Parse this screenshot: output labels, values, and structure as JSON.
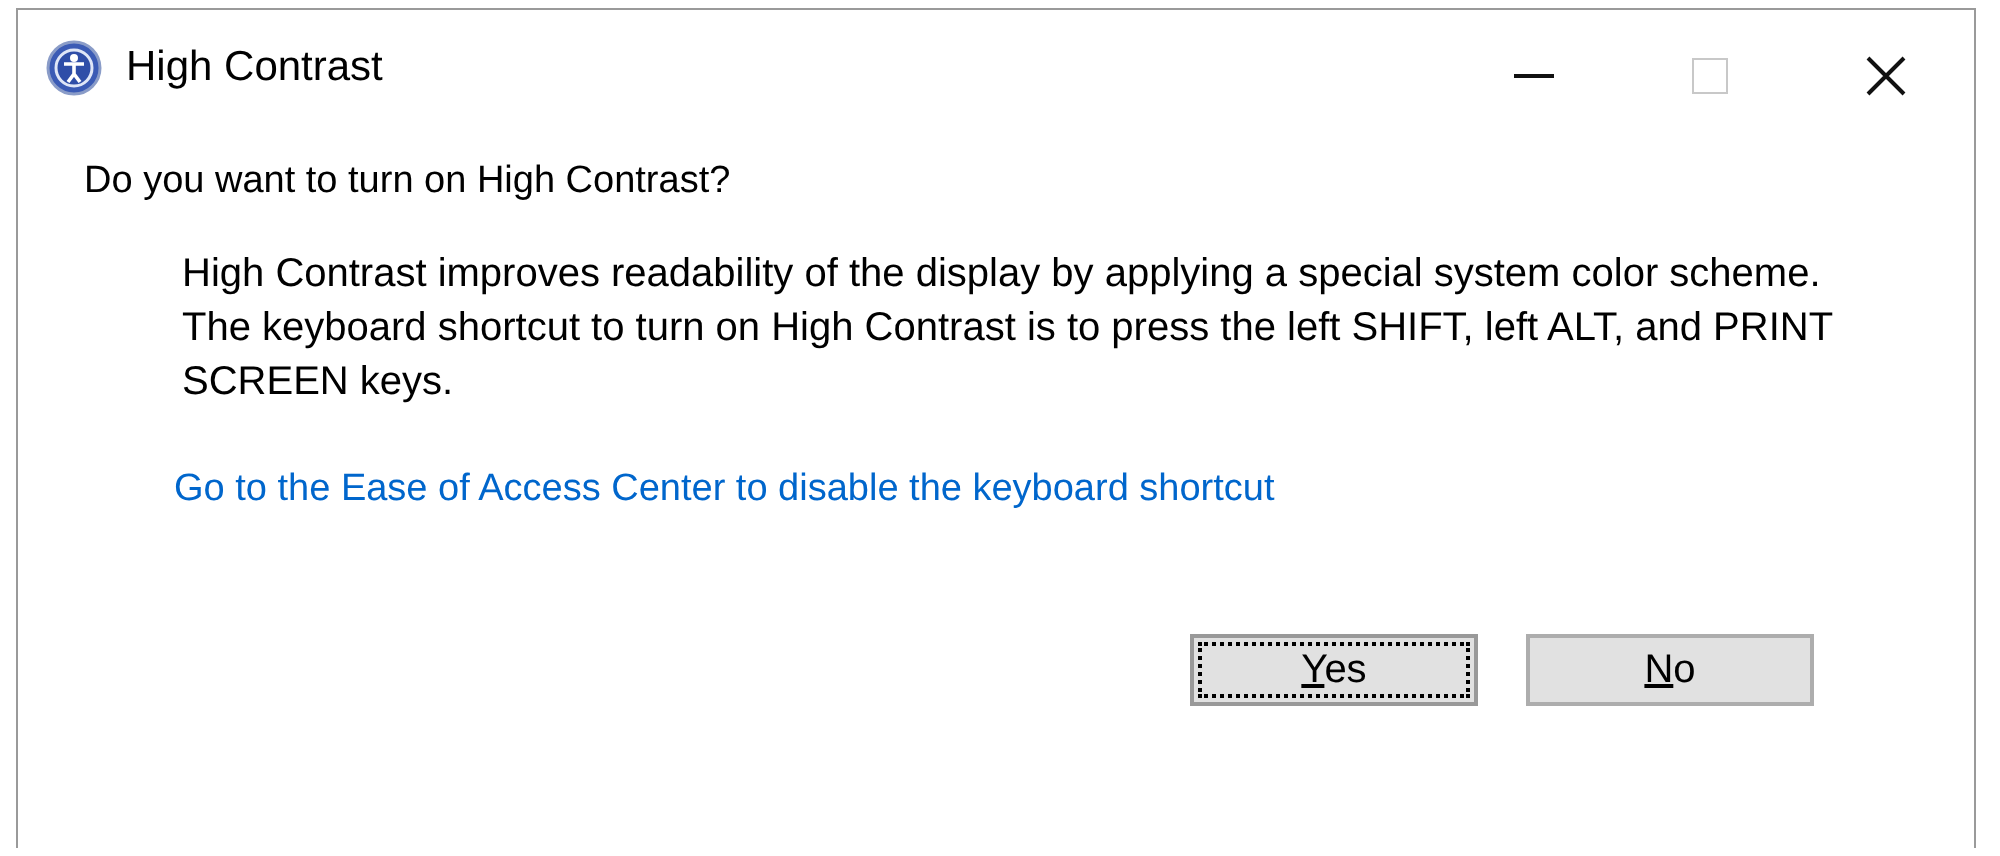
{
  "window": {
    "title": "High Contrast",
    "controls": [
      {
        "kind": "minimize",
        "disabled": false
      },
      {
        "kind": "maximize",
        "disabled": true
      },
      {
        "kind": "close",
        "disabled": false
      }
    ]
  },
  "question": "Do you want to turn on High Contrast?",
  "description": "High Contrast improves readability of the display by applying a special system color scheme.  The keyboard shortcut to turn on High Contrast is to press the left SHIFT, left ALT, and PRINT SCREEN keys.",
  "link": "Go to the Ease of Access Center to disable the keyboard shortcut",
  "buttons": [
    {
      "access_key": "Y",
      "label_rest": "es",
      "focused": true
    },
    {
      "access_key": "N",
      "label_rest": "o",
      "focused": false
    }
  ]
}
